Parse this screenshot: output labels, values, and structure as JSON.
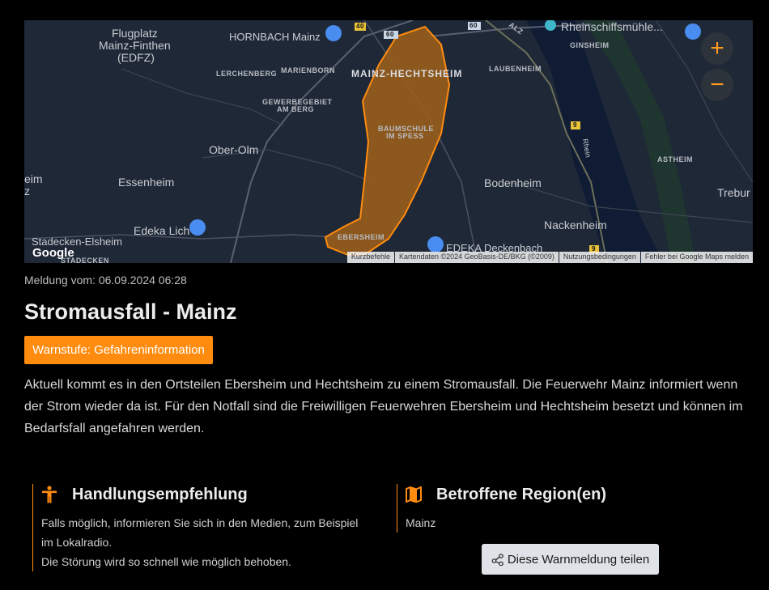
{
  "map": {
    "labels": {
      "flugplatz": "Flugplatz",
      "flugplatz2": "Mainz-Finthen",
      "flugplatz3": "(EDFZ)",
      "hornbach": "HORNBACH Mainz",
      "lerchenberg": "LERCHENBERG",
      "marienborn": "MARIENBORN",
      "hechtsheim": "MAINZ-HECHTSHEIM",
      "gewerbe1": "GEWERBEGEBIET",
      "gewerbe2": "AM BERG",
      "baumschule1": "BAUMSCHULE",
      "baumschule2": "IM SPESS",
      "oberolm": "Ober-Olm",
      "essenheim": "Essenheim",
      "eim": "eim",
      "z": "z",
      "edekalich": "Edeka Lich",
      "stadecken": "Stadecken-Elsheim",
      "stadecken2": "STADECKEN",
      "ebersheim": "EBERSHEIM",
      "edekadeck": "EDEKA Deckenbach",
      "rheinschiff": "Rheinschiffsmühle...",
      "ginsheim": "GINSHEIM",
      "laubenheim": "LAUBENHEIM",
      "bodenheim": "Bodenheim",
      "nackenheim": "Nackenheim",
      "astheim": "ASTHEIM",
      "trebur": "Trebur",
      "rhein": "Rhein",
      "alz": "ALZ",
      "road40": "40",
      "road60a": "60",
      "road60b": "60",
      "road9a": "9",
      "road9b": "9"
    },
    "zoom_in": "+",
    "zoom_out": "−",
    "google": "Google",
    "attribution": {
      "shortcuts": "Kurzbefehle",
      "mapdata": "Kartendaten ©2024 GeoBasis-DE/BKG (©2009)",
      "terms": "Nutzungsbedingungen",
      "report": "Fehler bei Google Maps melden"
    }
  },
  "meta": "Meldung vom: 06.09.2024 06:28",
  "title": "Stromausfall - Mainz",
  "badge": "Warnstufe: Gefahreninformation",
  "description": "Aktuell kommt es in den Ortsteilen Ebersheim und Hechtsheim zu einem Stromausfall. Die Feuerwehr Mainz informiert wenn der Strom wieder da ist. Für den Notfall sind die Freiwilligen Feuerwehren Ebersheim und Hechtsheim besetzt und können im Bedarfsfall angefahren werden.",
  "recommendation": {
    "heading": "Handlungsempfehlung",
    "line1": "Falls möglich, informieren Sie sich in den Medien, zum Beispiel",
    "line2": "im Lokalradio.",
    "line3": "Die Störung wird so schnell wie möglich behoben."
  },
  "region": {
    "heading": "Betroffene Region(en)",
    "value": "Mainz"
  },
  "share_button": "Diese Warnmeldung teilen",
  "colors": {
    "accent": "#ff8c0f",
    "map_bg": "#1f2837",
    "background": "#000000"
  }
}
